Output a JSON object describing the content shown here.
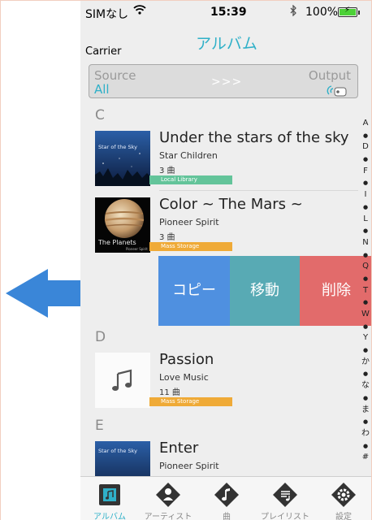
{
  "status": {
    "carrier": "SIMなし",
    "time": "15:39",
    "battery": "100%"
  },
  "nav": {
    "title": "アルバム",
    "carrier_label": "Carrier"
  },
  "io_bar": {
    "source_label": "Source",
    "source_value": "All",
    "arrows": ">>>",
    "output_label": "Output"
  },
  "sections": {
    "c": "C",
    "d": "D",
    "e": "E"
  },
  "albums": [
    {
      "title": "Under the stars of the sky",
      "artist": "Star Children",
      "count": "3 曲",
      "badge": "Local Library",
      "art_text": "Star of the Sky"
    },
    {
      "title": "Color ~ The Mars ~",
      "artist": "Pioneer Spirit",
      "count": "3 曲",
      "badge": "Mass Storage",
      "art_text": "The Planets",
      "art_sub": "Pioneer Spirit"
    },
    {
      "title": "Passion",
      "artist": "Love Music",
      "count": "11 曲",
      "badge": "Mass Storage"
    },
    {
      "title": "Enter",
      "artist": "Pioneer Spirit",
      "art_text": "Star of the Sky"
    }
  ],
  "actions": {
    "copy": "コピー",
    "move": "移動",
    "delete": "削除"
  },
  "index": [
    "A",
    "●",
    "D",
    "●",
    "F",
    "●",
    "I",
    "●",
    "L",
    "●",
    "N",
    "●",
    "Q",
    "●",
    "T",
    "●",
    "W",
    "●",
    "Y",
    "●",
    "か",
    "●",
    "な",
    "●",
    "ま",
    "●",
    "わ",
    "●",
    "#"
  ],
  "tabs": [
    {
      "label": "アルバム",
      "icon": "album-icon"
    },
    {
      "label": "アーティスト",
      "icon": "artist-icon"
    },
    {
      "label": "曲",
      "icon": "song-icon"
    },
    {
      "label": "プレイリスト",
      "icon": "playlist-icon"
    },
    {
      "label": "設定",
      "icon": "settings-icon"
    }
  ],
  "colors": {
    "accent": "#2fb0c8",
    "copy": "#4f90e0",
    "move": "#58aab4",
    "delete": "#e26b6b",
    "badge_local": "#63c49a",
    "badge_mass": "#efaa37",
    "arrow": "#3a86d8"
  }
}
